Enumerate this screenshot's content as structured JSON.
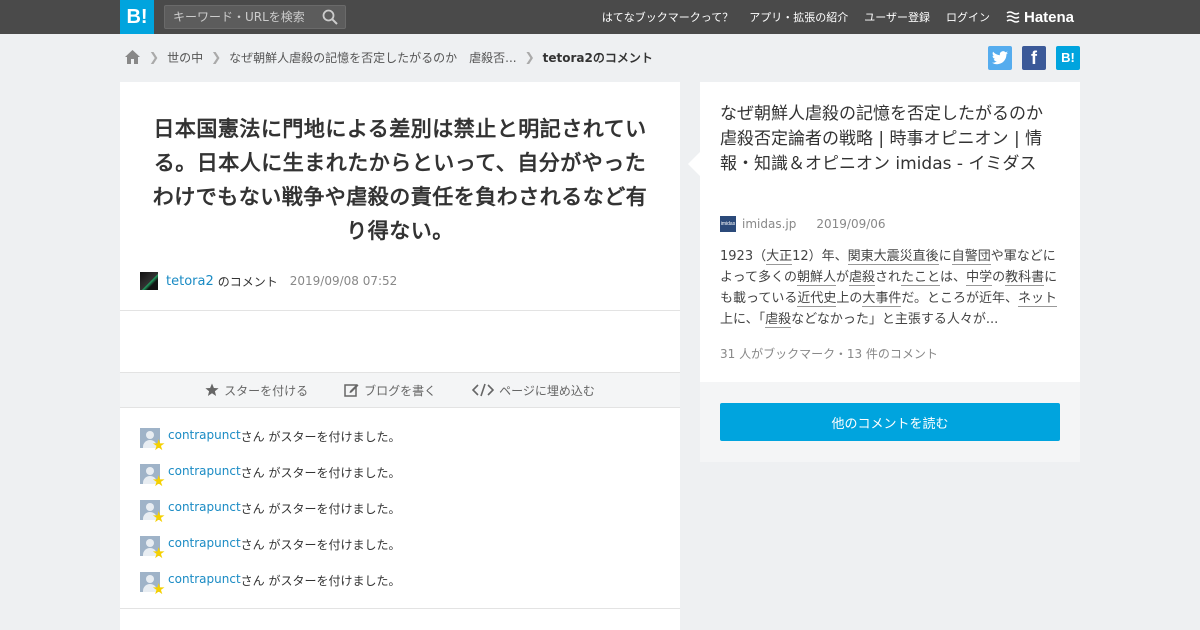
{
  "header": {
    "logo": "B!",
    "search_placeholder": "キーワード・URLを検索",
    "nav": [
      "はてなブックマークって？",
      "アプリ・拡張の紹介",
      "ユーザー登録",
      "ログイン"
    ],
    "brand": "Hatena",
    "brand_color": "#00a4de"
  },
  "breadcrumb": {
    "items": [
      "世の中",
      "なぜ朝鮮人虐殺の記憶を否定したがるのか　虐殺否..."
    ],
    "current": "tetora2のコメント"
  },
  "share": {
    "twitter": "t",
    "facebook": "f",
    "hatena": "B!"
  },
  "comment": {
    "text": "日本国憲法に門地による差別は禁止と明記されている。日本人に生まれたからといって、自分がやったわけでもない戦争や虐殺の責任を負わされるなど有り得ない。",
    "user": "tetora2",
    "suffix": "のコメント",
    "date": "2019/09/08 07:52"
  },
  "actions": {
    "star": "スターを付ける",
    "blog": "ブログを書く",
    "embed": "ページに埋め込む"
  },
  "stars": [
    {
      "name": "contrapunct",
      "text": "さん がスターを付けました。"
    },
    {
      "name": "contrapunct",
      "text": "さん がスターを付けました。"
    },
    {
      "name": "contrapunct",
      "text": "さん がスターを付けました。"
    },
    {
      "name": "contrapunct",
      "text": "さん がスターを付けました。"
    },
    {
      "name": "contrapunct",
      "text": "さん がスターを付けました。"
    }
  ],
  "article": {
    "title": "なぜ朝鮮人虐殺の記憶を否定したがるのか　虐殺否定論者の戦略 | 時事オピニオン | 情報・知識＆オピニオン imidas - イミダス",
    "source": "imidas.jp",
    "source_icon": "imidas",
    "date": "2019/09/06",
    "summary_parts": [
      {
        "t": "1923（"
      },
      {
        "t": "大正",
        "u": true
      },
      {
        "t": "12）年、"
      },
      {
        "t": "関東大震災",
        "u": true
      },
      {
        "t": "直後",
        "u": true
      },
      {
        "t": "に"
      },
      {
        "t": "自警団",
        "u": true
      },
      {
        "t": "や軍などによって多くの"
      },
      {
        "t": "朝鮮人",
        "u": true
      },
      {
        "t": "が"
      },
      {
        "t": "虐殺",
        "u": true
      },
      {
        "t": "され"
      },
      {
        "t": "たこと",
        "u": true
      },
      {
        "t": "は、"
      },
      {
        "t": "中学",
        "u": true
      },
      {
        "t": "の"
      },
      {
        "t": "教科書",
        "u": true
      },
      {
        "t": "にも載っている"
      },
      {
        "t": "近代史",
        "u": true
      },
      {
        "t": "上の"
      },
      {
        "t": "大事件",
        "u": true
      },
      {
        "t": "だ。ところが近年、"
      },
      {
        "t": "ネット",
        "u": true
      },
      {
        "t": "上に、「"
      },
      {
        "t": "虐殺",
        "u": true
      },
      {
        "t": "などなかった」と主張する人々が..."
      }
    ],
    "counts": "31 人がブックマーク・13 件のコメント",
    "read_button": "他のコメントを読む"
  }
}
